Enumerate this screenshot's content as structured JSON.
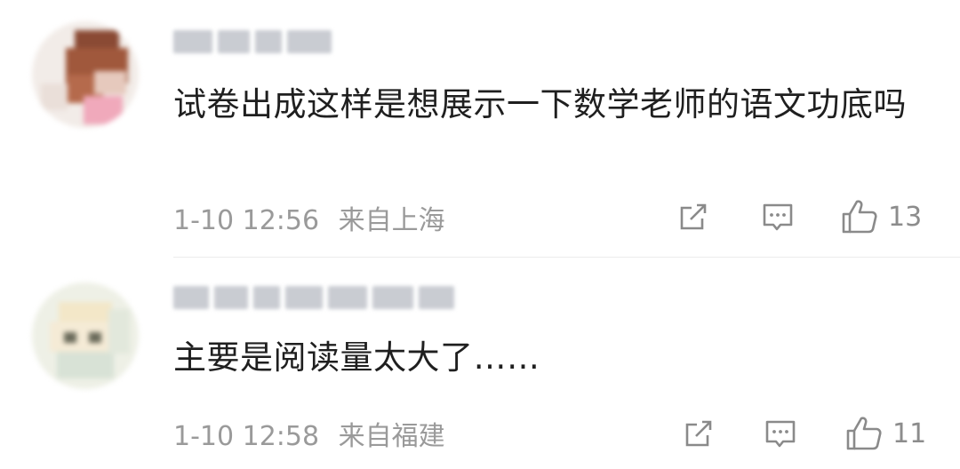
{
  "comments": [
    {
      "text": "试卷出成这样是想展示一下数学老师的语文功底吗",
      "time": "1-10 12:56",
      "location": "来自上海",
      "likes": "13",
      "share_icon": "share-icon",
      "reply_icon": "comment-icon",
      "like_icon": "thumbs-up-icon"
    },
    {
      "text": "主要是阅读量太大了……",
      "time": "1-10 12:58",
      "location": "来自福建",
      "likes": "11",
      "share_icon": "share-icon",
      "reply_icon": "comment-icon",
      "like_icon": "thumbs-up-icon"
    }
  ]
}
